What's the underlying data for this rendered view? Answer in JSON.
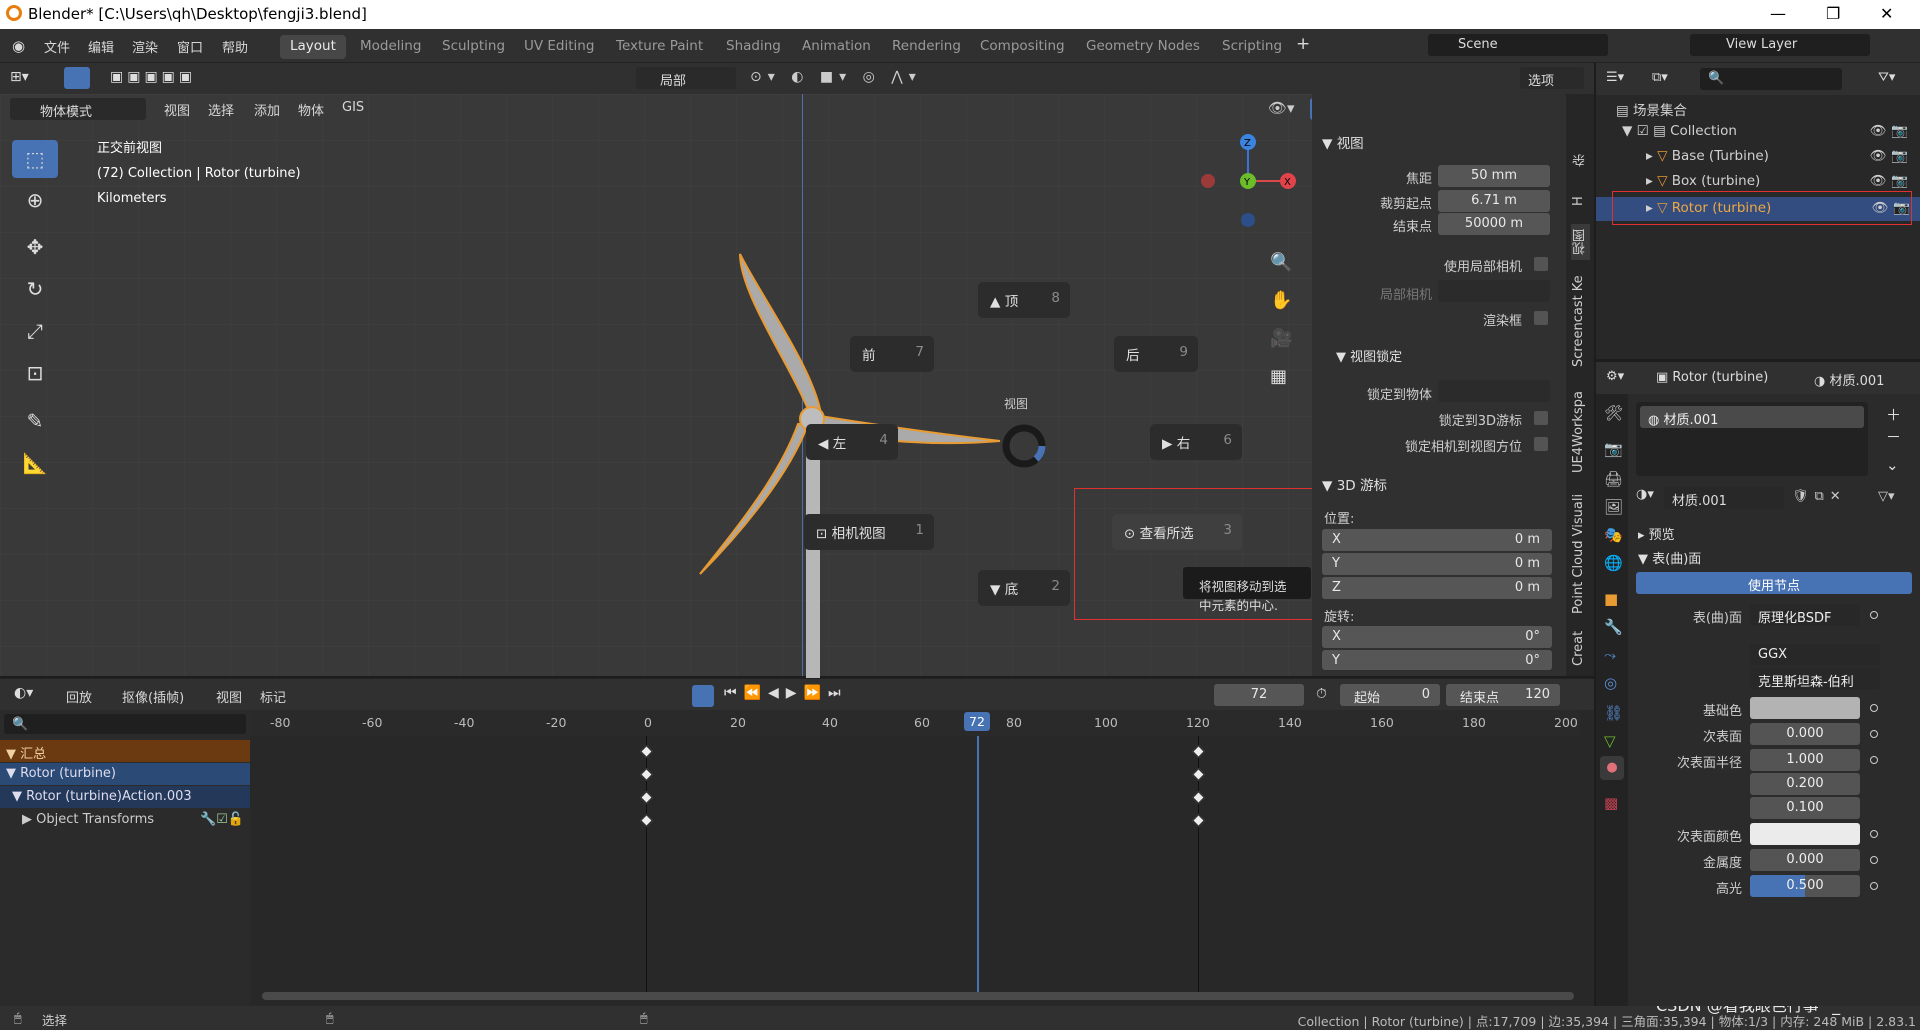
{
  "window": {
    "title": "Blender* [C:\\Users\\qh\\Desktop\\fengji3.blend]",
    "min": "—",
    "max": "❐",
    "close": "✕"
  },
  "menu": [
    "文件",
    "编辑",
    "渲染",
    "窗口",
    "帮助"
  ],
  "workspaces": [
    "Layout",
    "Modeling",
    "Sculpting",
    "UV Editing",
    "Texture Paint",
    "Shading",
    "Animation",
    "Rendering",
    "Compositing",
    "Geometry Nodes",
    "Scripting"
  ],
  "scene": "Scene",
  "view_layer": "View Layer",
  "viewport": {
    "mode": "物体模式",
    "menus": [
      "视图",
      "选择",
      "添加",
      "物体",
      "GIS"
    ],
    "transform": "局部",
    "options": "选项",
    "overlay_lines": [
      "正交前视图",
      "(72) Collection | Rotor (turbine)",
      "Kilometers"
    ],
    "gizmo": {
      "z": "Z",
      "y": "Y",
      "x": "X"
    },
    "pie_title": "视图",
    "pie": [
      {
        "label": "顶",
        "key": "8"
      },
      {
        "label": "前",
        "key": "7"
      },
      {
        "label": "后",
        "key": "9"
      },
      {
        "label": "左",
        "key": "4"
      },
      {
        "label": "右",
        "key": "6"
      },
      {
        "label": "相机视图",
        "key": "1"
      },
      {
        "label": "查看所选",
        "key": "3"
      },
      {
        "label": "底",
        "key": "2"
      }
    ],
    "tooltip": "将视图移动到选中元素的中心."
  },
  "npanel": {
    "view_header": "视图",
    "focal_label": "焦距",
    "focal": "50 mm",
    "clip_start_label": "裁剪起点",
    "clip_start": "6.71 m",
    "clip_end_label": "结束点",
    "clip_end": "50000 m",
    "local_cam_label": "使用局部相机",
    "local_cam2": "局部相机",
    "render_border": "渲染框",
    "lock_header": "视图锁定",
    "lock_obj": "锁定到物体",
    "lock_cursor": "锁定到3D游标",
    "lock_cam": "锁定相机到视图方位",
    "cursor_header": "3D 游标",
    "location": "位置:",
    "x": "X",
    "y": "Y",
    "z": "Z",
    "xv": "0 m",
    "yv": "0 m",
    "zv": "0 m",
    "rotation": "旋转:",
    "rx": "X",
    "rxv": "0°",
    "ry": "Y",
    "ryv": "0°",
    "tabs": [
      "Creat",
      "Point Cloud Visuali",
      "UE4Workspa",
      "Screencast Ke",
      "视图",
      "H",
      "杂"
    ]
  },
  "timeline": {
    "menus": [
      "回放",
      "抠像(插帧)",
      "视图",
      "标记"
    ],
    "current": "72",
    "start_label": "起始",
    "start": "0",
    "end_label": "结束点",
    "end": "120",
    "ticks": [
      "-80",
      "-60",
      "-40",
      "-20",
      "0",
      "20",
      "40",
      "60",
      "72",
      "80",
      "100",
      "120",
      "140",
      "160",
      "180",
      "200"
    ],
    "rows": [
      "汇总",
      "Rotor (turbine)",
      "Rotor (turbine)Action.003",
      "Object Transforms"
    ]
  },
  "status": {
    "left": "选择",
    "right": "Collection | Rotor (turbine) | 点:17,709 | 边:35,394 | 三角面:35,394 | 物体:1/3 | 内存: 248 MiB | 2.83.1",
    "watermark": "CSDN @看我眼色行事^_^"
  },
  "outliner": {
    "root": "场景集合",
    "items": [
      {
        "name": "Collection"
      },
      {
        "name": "Base (Turbine)"
      },
      {
        "name": "Box (turbine)"
      },
      {
        "name": "Rotor (turbine)"
      }
    ]
  },
  "properties": {
    "object": "Rotor (turbine)",
    "material": "材质.001",
    "slot": "材质.001",
    "mat_field": "材质.001",
    "preview": "预览",
    "surface": "表(曲)面",
    "use_nodes": "使用节点",
    "rows": [
      {
        "label": "表(曲)面",
        "value": "原理化BSDF"
      },
      {
        "label": "",
        "value": "GGX"
      },
      {
        "label": "",
        "value": "克里斯坦森-伯利"
      },
      {
        "label": "基础色",
        "value": ""
      },
      {
        "label": "次表面",
        "value": "0.000"
      },
      {
        "label": "次表面半径",
        "value": "1.000"
      },
      {
        "label": "",
        "value": "0.200"
      },
      {
        "label": "",
        "value": "0.100"
      },
      {
        "label": "次表面颜色",
        "value": ""
      },
      {
        "label": "金属度",
        "value": "0.000"
      },
      {
        "label": "高光",
        "value": "0.500"
      }
    ]
  },
  "colors": {
    "accent": "#4772b3",
    "orange": "#e8a040",
    "selected": "#e59b2d"
  }
}
